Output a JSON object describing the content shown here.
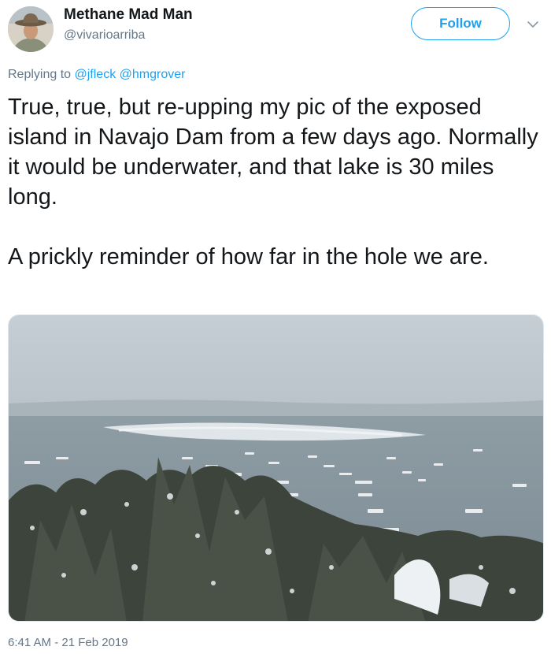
{
  "author": {
    "display_name": "Methane Mad Man",
    "handle": "@vivarioarriba",
    "avatar_icon": "avatar-cowboy-hat"
  },
  "follow_button": {
    "label": "Follow",
    "color": "#1da1f2"
  },
  "menu_icon": "chevron-down-icon",
  "reply": {
    "prefix": "Replying to",
    "mentions": [
      "@jfleck",
      "@hmgrover"
    ]
  },
  "tweet": {
    "paragraphs": [
      "True, true, but re-upping my pic of the exposed island in Navajo Dam from a few days ago.  Normally it would be underwater, and that lake is 30 miles long.",
      "A prickly reminder of how far in the hole we are."
    ],
    "timestamp": "6:41 AM - 21 Feb 2019"
  },
  "colors": {
    "text": "#14171a",
    "secondary": "#657786",
    "link": "#1da1f2"
  }
}
